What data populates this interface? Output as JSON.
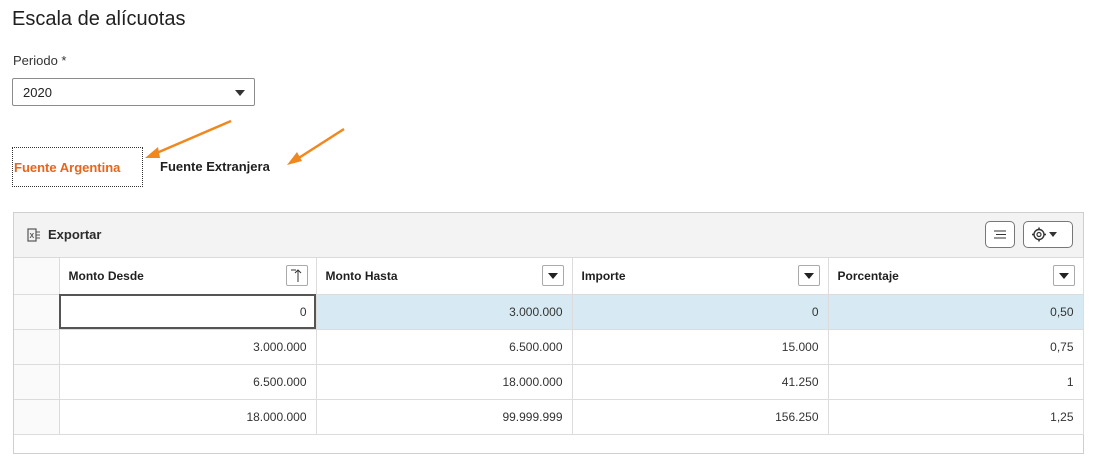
{
  "page_title": "Escala de alícuotas",
  "periodo": {
    "label": "Periodo *",
    "value": "2020"
  },
  "tabs": [
    {
      "label": "Fuente Argentina",
      "active": true
    },
    {
      "label": "Fuente Extranjera",
      "active": false
    }
  ],
  "toolbar": {
    "export_label": "Exportar"
  },
  "columns": [
    "Monto Desde",
    "Monto Hasta",
    "Importe",
    "Porcentaje"
  ],
  "rows": [
    [
      "0",
      "3.000.000",
      "0",
      "0,50"
    ],
    [
      "3.000.000",
      "6.500.000",
      "15.000",
      "0,75"
    ],
    [
      "6.500.000",
      "18.000.000",
      "41.250",
      "1"
    ],
    [
      "18.000.000",
      "99.999.999",
      "156.250",
      "1,25"
    ]
  ],
  "colors": {
    "accent": "#e8651a",
    "selected_row": "#d7eaf3"
  }
}
